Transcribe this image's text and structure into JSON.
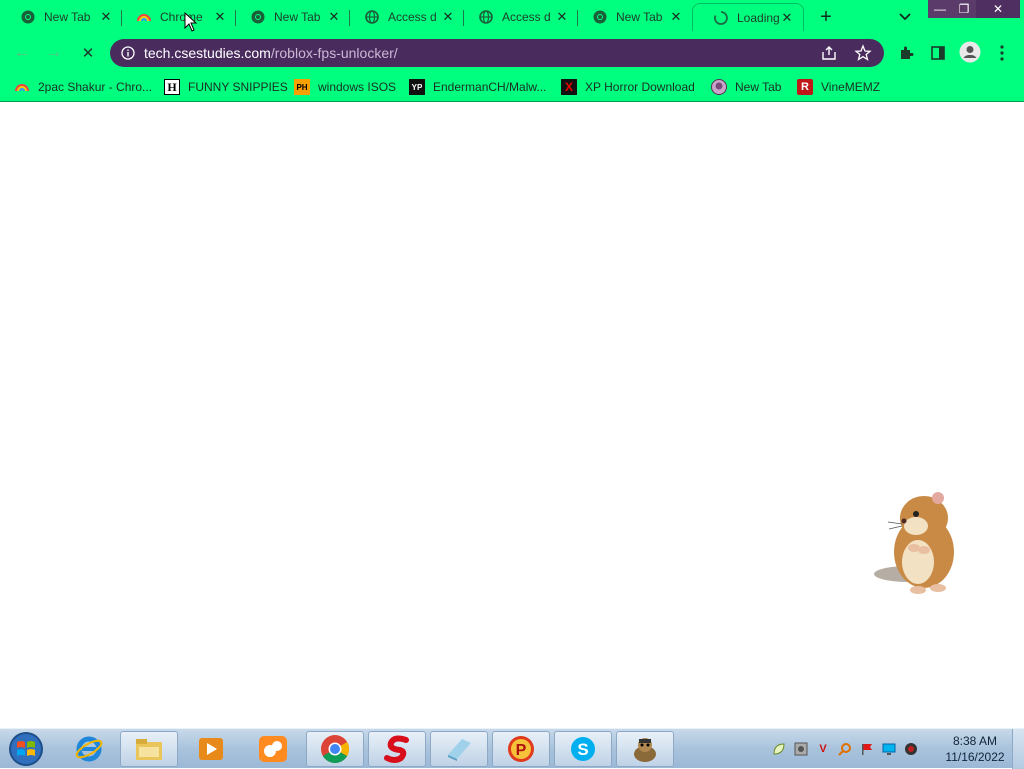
{
  "tabs": [
    {
      "title": "New Tab",
      "favicon": "chrome-icon"
    },
    {
      "title": "Chrome",
      "favicon": "rainbow-icon"
    },
    {
      "title": "New Tab",
      "favicon": "chrome-icon"
    },
    {
      "title": "Access d",
      "favicon": "globe-icon"
    },
    {
      "title": "Access d",
      "favicon": "globe-icon"
    },
    {
      "title": "New Tab",
      "favicon": "chrome-icon"
    },
    {
      "title": "Loading...",
      "favicon": "spinner-icon",
      "active": true
    }
  ],
  "tab_close_glyph": "✕",
  "new_tab_glyph": "+",
  "window_controls": {
    "minimize": "—",
    "maximize": "❐",
    "close": "✕"
  },
  "toolbar": {
    "url_host": "tech.csestudies.com",
    "url_path": "/roblox-fps-unlocker/",
    "back_glyph": "←",
    "forward_glyph": "→",
    "loading_glyph": "✕"
  },
  "bookmarks": [
    {
      "label": "2pac Shakur - Chro...",
      "icon": "rainbow-icon"
    },
    {
      "label": "FUNNY SNIPPIES",
      "icon": "h-icon",
      "glyph": "H"
    },
    {
      "label": "windows ISOS",
      "icon": "ph-icon",
      "glyph": "PH"
    },
    {
      "label": "EndermanCH/Malw...",
      "icon": "yp-icon",
      "glyph": "YP"
    },
    {
      "label": "XP Horror Download",
      "icon": "x-icon",
      "glyph": "X"
    },
    {
      "label": "New Tab",
      "icon": "avatar-icon"
    },
    {
      "label": "VineMEMZ",
      "icon": "r-icon",
      "glyph": "R"
    }
  ],
  "taskbar": {
    "apps": [
      "internet-explorer-icon",
      "file-explorer-icon",
      "media-player-icon",
      "uc-browser-icon",
      "chrome-icon",
      "s-app-icon",
      "notepad-icon",
      "p-app-icon",
      "skype-icon",
      "bonzi-icon"
    ],
    "clock_time": "8:38 AM",
    "clock_date": "11/16/2022"
  },
  "colors": {
    "chrome_frame": "#00ff7f",
    "omnibox_bg": "#4a2b5e",
    "taskbar": "#a9c3dc"
  }
}
